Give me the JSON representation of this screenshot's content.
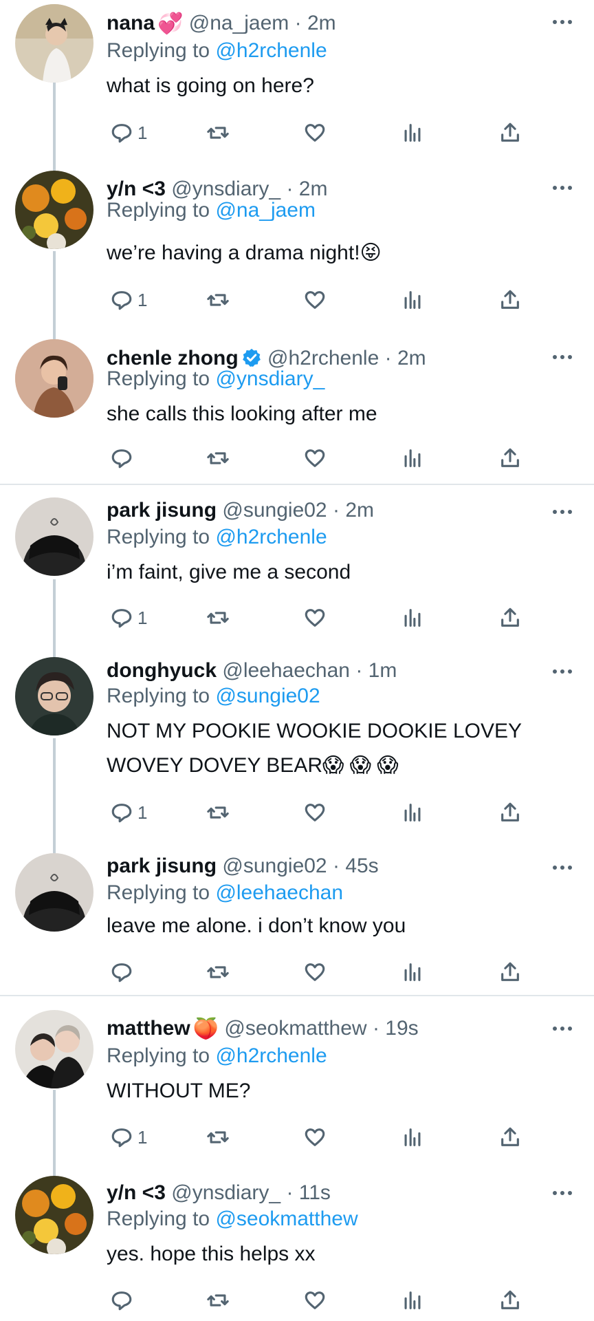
{
  "colors": {
    "link": "#1d9bf0",
    "muted": "#536471",
    "text": "#0f1419",
    "verified": "#1d9bf0"
  },
  "tweets": [
    {
      "name": "nana",
      "emoji": "💞",
      "handle": "@na_jaem",
      "dot": "·",
      "time": "2m",
      "replying": "Replying to",
      "reply_to": "@h2rchenle",
      "lines": [
        "what is going on here?"
      ],
      "reply_count": "1",
      "verified": false
    },
    {
      "name": "y/n <3",
      "emoji": "",
      "handle": "@ynsdiary_",
      "dot": "·",
      "time": "2m",
      "replying": "Replying to",
      "reply_to": "@na_jaem",
      "lines": [
        "we’re having a drama night!😝"
      ],
      "reply_count": "1",
      "verified": false
    },
    {
      "name": "chenle zhong",
      "emoji": "",
      "handle": "@h2rchenle",
      "dot": "·",
      "time": "2m",
      "replying": "Replying to",
      "reply_to": "@ynsdiary_",
      "lines": [
        "she calls this looking after me"
      ],
      "reply_count": "",
      "verified": true
    },
    {
      "name": "park jisung",
      "emoji": "",
      "handle": "@sungie02",
      "dot": "·",
      "time": "2m",
      "replying": "Replying to",
      "reply_to": "@h2rchenle",
      "lines": [
        "i’m faint, give me a second"
      ],
      "reply_count": "1",
      "verified": false
    },
    {
      "name": "donghyuck",
      "emoji": "",
      "handle": "@leehaechan",
      "dot": "·",
      "time": "1m",
      "replying": "Replying to",
      "reply_to": "@sungie02",
      "lines": [
        "NOT MY POOKIE WOOKIE DOOKIE LOVEY",
        "WOVEY DOVEY BEAR😱 😱 😱"
      ],
      "reply_count": "1",
      "verified": false
    },
    {
      "name": "park jisung",
      "emoji": "",
      "handle": "@sungie02",
      "dot": "·",
      "time": "45s",
      "replying": "Replying to",
      "reply_to": "@leehaechan",
      "lines": [
        "leave me alone. i don’t know you"
      ],
      "reply_count": "",
      "verified": false
    },
    {
      "name": "matthew",
      "emoji": "🍑",
      "handle": "@seokmatthew",
      "dot": "·",
      "time": "19s",
      "replying": "Replying to",
      "reply_to": "@h2rchenle",
      "lines": [
        "WITHOUT ME?"
      ],
      "reply_count": "1",
      "verified": false
    },
    {
      "name": "y/n <3",
      "emoji": "",
      "handle": "@ynsdiary_",
      "dot": "·",
      "time": "11s",
      "replying": "Replying to",
      "reply_to": "@seokmatthew",
      "lines": [
        "yes. hope this helps xx"
      ],
      "reply_count": "",
      "verified": false
    }
  ]
}
